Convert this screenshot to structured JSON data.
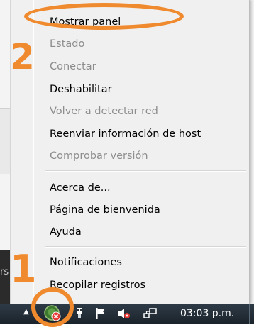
{
  "menu": {
    "items": [
      {
        "label": "Mostrar panel",
        "enabled": true
      },
      {
        "label": "Estado",
        "enabled": false
      },
      {
        "label": "Conectar",
        "enabled": false
      },
      {
        "label": "Deshabilitar",
        "enabled": true
      },
      {
        "label": "Volver a detectar red",
        "enabled": false
      },
      {
        "label": "Reenviar información de host",
        "enabled": true
      },
      {
        "label": "Comprobar versión",
        "enabled": false
      },
      {
        "label": "Acerca de...",
        "enabled": true
      },
      {
        "label": "Página de bienvenida",
        "enabled": true
      },
      {
        "label": "Ayuda",
        "enabled": true
      },
      {
        "label": "Notificaciones",
        "enabled": true
      },
      {
        "label": "Recopilar registros",
        "enabled": true
      }
    ]
  },
  "annotations": {
    "step_one": "1",
    "step_two": "2",
    "color": "#f08a2e"
  },
  "taskbar": {
    "clock": "03:03 p.m.",
    "icons": [
      "show-hidden-icons-arrow",
      "app-tray-icon-error",
      "usb-device-icon",
      "action-center-flag-icon",
      "volume-muted-icon",
      "network-icon"
    ]
  },
  "background": {
    "left_strip_text": "rs"
  }
}
